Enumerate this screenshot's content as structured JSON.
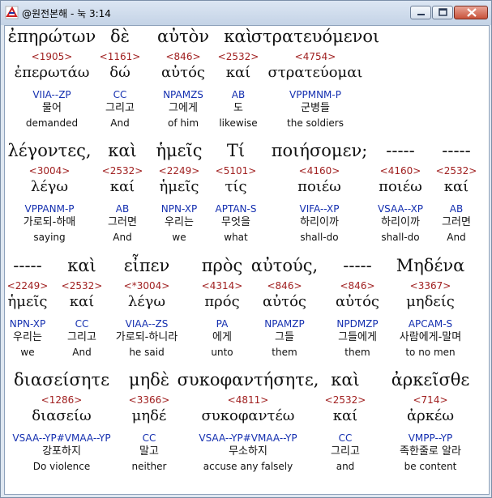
{
  "window": {
    "title": "@원전본해 - 눅 3:14",
    "icon": "app-logo-icon",
    "controls": [
      "minimize-icon",
      "maximize-icon",
      "close-icon"
    ]
  },
  "rows": [
    {
      "words": [
        {
          "greek": "ἐπηρώτων",
          "strong": "<1905>",
          "lemma": "ἐπερωτάω",
          "parse": "VIIA--ZP",
          "ko": "물어",
          "en": "demanded"
        },
        {
          "greek": "δὲ",
          "strong": "<1161>",
          "lemma": "δώ",
          "parse": "CC",
          "ko": "그리고",
          "en": "And"
        },
        {
          "greek": "αὐτὸν",
          "strong": "<846>",
          "lemma": "αὐτός",
          "parse": "NPAMZS",
          "ko": "그에게",
          "en": "of him"
        },
        {
          "greek": "καὶ",
          "strong": "<2532>",
          "lemma": "καί",
          "parse": "AB",
          "ko": "도",
          "en": "likewise"
        },
        {
          "greek": "στρατευόμενοι",
          "strong": "<4754>",
          "lemma": "στρατεύομαι",
          "parse": "VPPMNM-P",
          "ko": "군병들",
          "en": "the soldiers"
        }
      ]
    },
    {
      "words": [
        {
          "greek": "λέγοντες,",
          "strong": "<3004>",
          "lemma": "λέγω",
          "parse": "VPPANM-P",
          "ko": "가로되-하매",
          "en": "saying"
        },
        {
          "greek": "καὶ",
          "strong": "<2532>",
          "lemma": "καί",
          "parse": "AB",
          "ko": "그러면",
          "en": "And"
        },
        {
          "greek": "ἡμεῖς",
          "strong": "<2249>",
          "lemma": "ἡμεῖς",
          "parse": "NPN-XP",
          "ko": "우리는",
          "en": "we"
        },
        {
          "greek": "Τί",
          "strong": "<5101>",
          "lemma": "τίς",
          "parse": "APTAN-S",
          "ko": "무엇을",
          "en": "what"
        },
        {
          "greek": "ποιήσομεν;",
          "strong": "<4160>",
          "lemma": "ποιέω",
          "parse": "VIFA--XP",
          "ko": "하리이까",
          "en": "shall-do"
        },
        {
          "greek": "-----",
          "strong": "<4160>",
          "lemma": "ποιέω",
          "parse": "VSAA--XP",
          "ko": "하리이까",
          "en": "shall-do"
        },
        {
          "greek": "-----",
          "strong": "<2532>",
          "lemma": "καί",
          "parse": "AB",
          "ko": "그러면",
          "en": "And"
        }
      ]
    },
    {
      "words": [
        {
          "greek": "-----",
          "strong": "<2249>",
          "lemma": "ἡμεῖς",
          "parse": "NPN-XP",
          "ko": "우리는",
          "en": "we"
        },
        {
          "greek": "καὶ",
          "strong": "<2532>",
          "lemma": "καί",
          "parse": "CC",
          "ko": "그리고",
          "en": "And"
        },
        {
          "greek": "εἶπεν",
          "strong": "<*3004>",
          "lemma": "λέγω",
          "parse": "VIAA--ZS",
          "ko": "가로되-하니라",
          "en": "he said"
        },
        {
          "greek": "πρὸς",
          "strong": "<4314>",
          "lemma": "πρός",
          "parse": "PA",
          "ko": "에게",
          "en": "unto"
        },
        {
          "greek": "αὐτούς,",
          "strong": "<846>",
          "lemma": "αὐτός",
          "parse": "NPAMZP",
          "ko": "그들",
          "en": "them"
        },
        {
          "greek": "-----",
          "strong": "<846>",
          "lemma": "αὐτός",
          "parse": "NPDMZP",
          "ko": "그들에게",
          "en": "them"
        },
        {
          "greek": "Μηδένα",
          "strong": "<3367>",
          "lemma": "μηδείς",
          "parse": "APCAM-S",
          "ko": "사람에게-말며",
          "en": "to no men"
        }
      ]
    },
    {
      "words": [
        {
          "greek": "διασείσητε",
          "strong": "<1286>",
          "lemma": "διασείω",
          "parse": "VSAA--YP#VMAA--YP",
          "ko": "강포하지",
          "en": "Do violence"
        },
        {
          "greek": "μηδὲ",
          "strong": "<3366>",
          "lemma": "μηδέ",
          "parse": "CC",
          "ko": "말고",
          "en": "neither"
        },
        {
          "greek": "συκοφαντήσητε,",
          "strong": "<4811>",
          "lemma": "συκοφαντέω",
          "parse": "VSAA--YP#VMAA--YP",
          "ko": "무소하지",
          "en": "accuse any falsely"
        },
        {
          "greek": "καὶ",
          "strong": "<2532>",
          "lemma": "καί",
          "parse": "CC",
          "ko": "그리고",
          "en": "and"
        },
        {
          "greek": "ἀρκεῖσθε",
          "strong": "<714>",
          "lemma": "ἀρκέω",
          "parse": "VMPP--YP",
          "ko": "족한줄로 알라",
          "en": "be content"
        }
      ]
    }
  ]
}
